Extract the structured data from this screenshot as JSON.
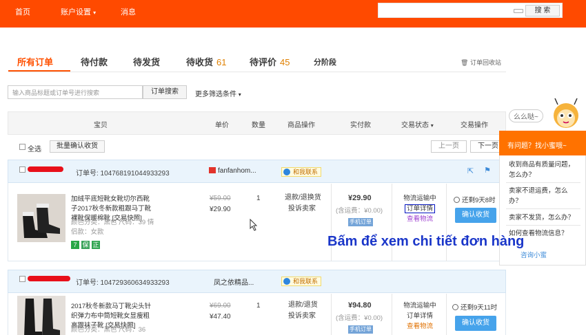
{
  "topnav": {
    "home": "首页",
    "account_settings": "账户设置",
    "messages": "消息",
    "search_button": "搜 索"
  },
  "tabs": [
    {
      "label": "所有订单",
      "count": ""
    },
    {
      "label": "待付款",
      "count": ""
    },
    {
      "label": "待发货",
      "count": ""
    },
    {
      "label": "待收货",
      "count": "61"
    },
    {
      "label": "待评价",
      "count": "45"
    },
    {
      "label": "分阶段",
      "count": ""
    }
  ],
  "recycle_bin": "订单回收站",
  "filter": {
    "placeholder": "输入商品标题或订单号进行搜索",
    "search_button": "订单搜索",
    "more_filters": "更多筛选条件"
  },
  "table_headers": [
    "宝贝",
    "单价",
    "数量",
    "商品操作",
    "实付款",
    "交易状态",
    "交易操作"
  ],
  "toolbar": {
    "select_all": "全选",
    "batch_confirm": "批量确认收货",
    "prev": "上一页",
    "next": "下一页"
  },
  "orders": [
    {
      "order_no": "订单号: 104768191044933293",
      "shop": "fanfanhom...",
      "contact": "和我联系",
      "title": "加绒平底短靴女靴切尔西靴子2017秋冬新款粗跟马丁靴裸靴保暖棉靴 [交易快照]",
      "attrs": "颜色分类：黑色  尺码：39  情侣款：女款",
      "price_original": "¥59.00",
      "price": "¥29.90",
      "qty": "1",
      "action1": "退款/退换货",
      "action2": "投诉卖家",
      "paid": "¥29.90",
      "shipping": "(含运费：¥0.00)",
      "mobile_tag": "手机订单",
      "status": "物流运输中",
      "detail": "订单详情",
      "logistics": "查看物流",
      "remaining": "还剩9天8时",
      "confirm": "确认收货"
    },
    {
      "order_no": "订单号: 104729360634933293",
      "shop": "凤之依精品...",
      "contact": "和我联系",
      "title": "2017秋冬新款马丁靴尖头针织弹力布中筒短靴女显瘦粗高跟袜子靴 [交易快照]",
      "attrs": "颜色分类：黑色  尺码：36",
      "price_original": "¥69.00",
      "price": "¥47.40",
      "qty": "1",
      "action1": "退款/退货",
      "action2": "投诉卖家",
      "paid": "¥94.80",
      "shipping": "(含运费：¥0.00)",
      "mobile_tag": "手机订单",
      "status": "物流运输中",
      "detail": "订单详情",
      "logistics": "查看物流",
      "remaining": "还剩9天11时",
      "confirm": "确认收货"
    }
  ],
  "helper": {
    "bubble": "么么哒~",
    "title": "有问题？找小蜜哦~",
    "items": [
      "收到商品有质量问题，怎么办？",
      "卖家不退运费，怎么办？",
      "卖家不发货，怎么办？",
      "如何查看物流信息？"
    ],
    "consult": "咨询小蜜"
  },
  "annotation": "Bấm để xem chi tiết đơn hàng",
  "colors": {
    "brand_orange": "#ff4a00",
    "annotation_blue": "#1a36c9",
    "highlight_box": "#0011c0"
  }
}
